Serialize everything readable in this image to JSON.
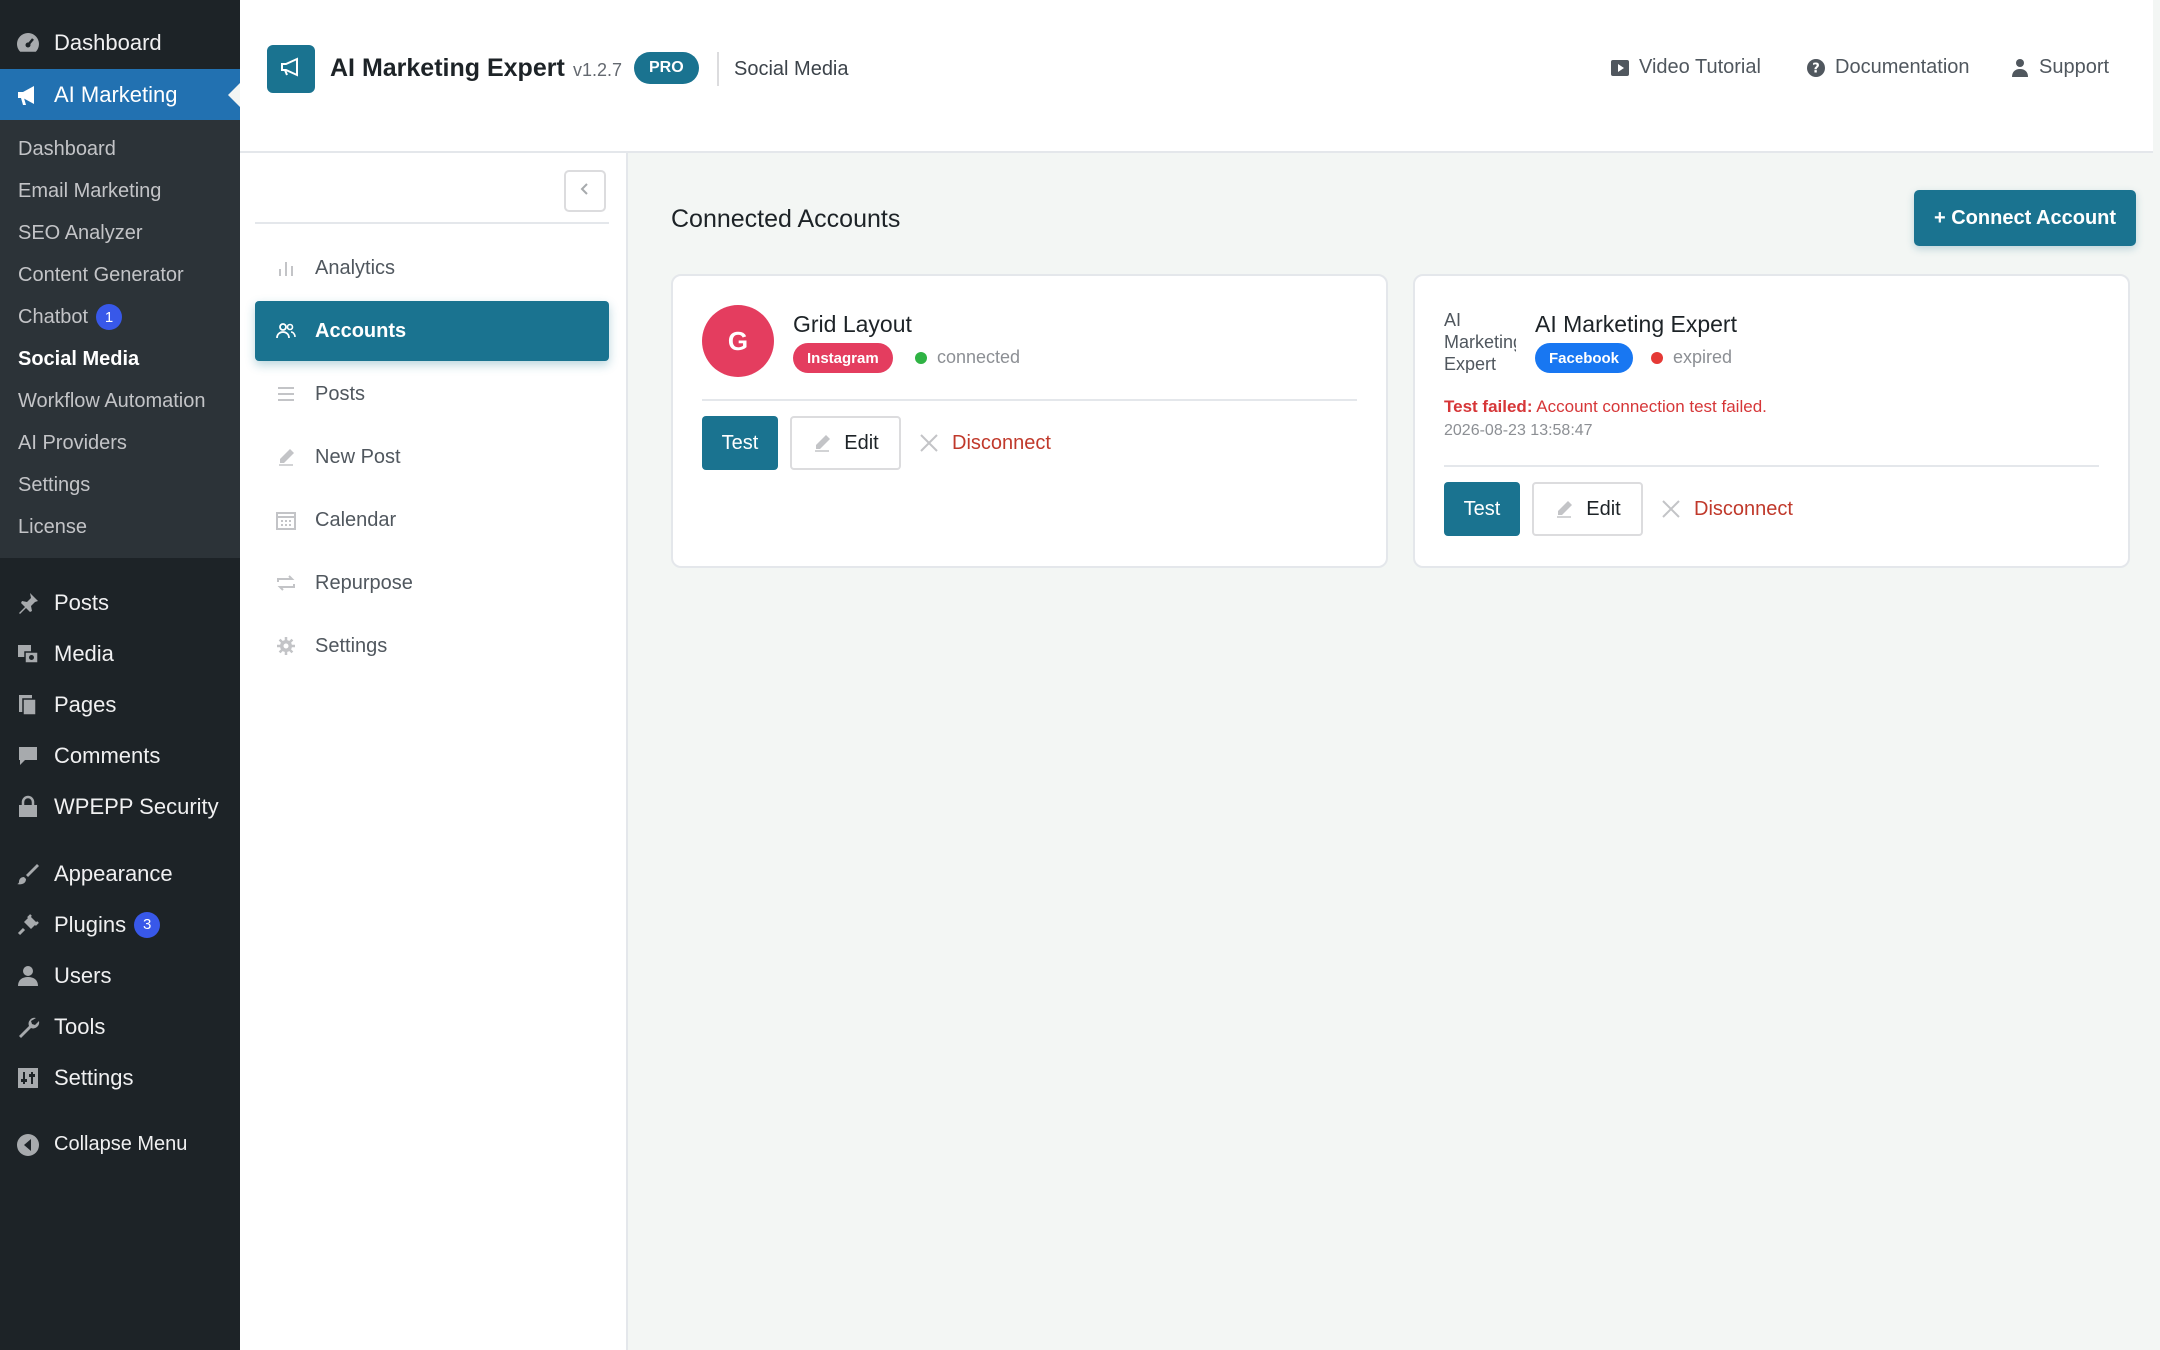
{
  "wp_menu": {
    "dashboard": "Dashboard",
    "ai_marketing": "AI Marketing",
    "submenu": [
      {
        "label": "Dashboard"
      },
      {
        "label": "Email Marketing"
      },
      {
        "label": "SEO Analyzer"
      },
      {
        "label": "Content Generator"
      },
      {
        "label": "Chatbot",
        "badge": "1"
      },
      {
        "label": "Social Media"
      },
      {
        "label": "Workflow Automation"
      },
      {
        "label": "AI Providers"
      },
      {
        "label": "Settings"
      },
      {
        "label": "License"
      }
    ],
    "posts": "Posts",
    "media": "Media",
    "pages": "Pages",
    "comments": "Comments",
    "security": "WPEPP Security",
    "appearance": "Appearance",
    "plugins": "Plugins",
    "plugins_badge": "3",
    "users": "Users",
    "tools": "Tools",
    "settings": "Settings",
    "collapse": "Collapse Menu"
  },
  "header": {
    "title": "AI Marketing Expert",
    "version": "v1.2.7",
    "badge": "PRO",
    "section": "Social Media",
    "links": {
      "video": "Video Tutorial",
      "docs": "Documentation",
      "support": "Support"
    }
  },
  "nav": {
    "items": [
      {
        "label": "Analytics",
        "icon": "bar-chart-icon"
      },
      {
        "label": "Accounts",
        "icon": "users-icon"
      },
      {
        "label": "Posts",
        "icon": "list-icon"
      },
      {
        "label": "New Post",
        "icon": "pencil-icon"
      },
      {
        "label": "Calendar",
        "icon": "calendar-icon"
      },
      {
        "label": "Repurpose",
        "icon": "repeat-icon"
      },
      {
        "label": "Settings",
        "icon": "gear-icon"
      }
    ],
    "active": "Accounts"
  },
  "main": {
    "title": "Connected Accounts",
    "connect_button": "+ Connect Account",
    "accounts": [
      {
        "avatar_letter": "G",
        "name": "Grid Layout",
        "platform": "Instagram",
        "status": "connected",
        "actions": {
          "test": "Test",
          "edit": "Edit",
          "disconnect": "Disconnect"
        }
      },
      {
        "avatar_alt": "AI Marketing Expert",
        "name": "AI Marketing Expert",
        "platform": "Facebook",
        "status": "expired",
        "error_label": "Test failed:",
        "error_message": "Account connection test failed.",
        "error_time": "2026-08-23 13:58:47",
        "actions": {
          "test": "Test",
          "edit": "Edit",
          "disconnect": "Disconnect"
        }
      }
    ]
  },
  "colors": {
    "accent": "#1a7390",
    "wp_active": "#2271b1",
    "instagram": "#e43d5f",
    "facebook": "#1877f2",
    "connected": "#2fb344",
    "expired": "#e53935",
    "danger": "#c0392b"
  }
}
